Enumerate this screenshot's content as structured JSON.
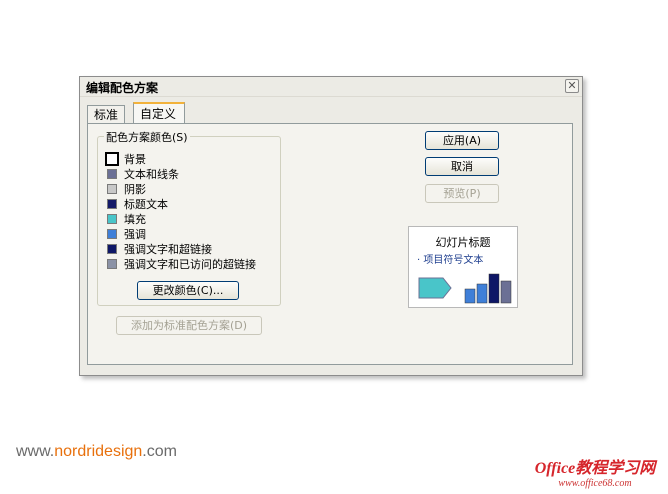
{
  "dialog": {
    "title": "编辑配色方案",
    "close_glyph": "✕",
    "tabs": [
      {
        "label": "标准",
        "active": false
      },
      {
        "label": "自定义",
        "active": true
      }
    ],
    "group_label": "配色方案颜色(S)",
    "colors": [
      {
        "label": "背景",
        "color": "#ffffff",
        "selected": true
      },
      {
        "label": "文本和线条",
        "color": "#6b7095",
        "selected": false
      },
      {
        "label": "阴影",
        "color": "#c8c8c8",
        "selected": false
      },
      {
        "label": "标题文本",
        "color": "#141a68",
        "selected": false
      },
      {
        "label": "填充",
        "color": "#49c5c9",
        "selected": false
      },
      {
        "label": "强调",
        "color": "#3f7fd8",
        "selected": false
      },
      {
        "label": "强调文字和超链接",
        "color": "#0e1666",
        "selected": false
      },
      {
        "label": "强调文字和已访问的超链接",
        "color": "#8b92a6",
        "selected": false
      }
    ],
    "change_color_button": "更改颜色(C)...",
    "add_scheme_button": "添加为标准配色方案(D)",
    "apply_button": "应用(A)",
    "cancel_button": "取消",
    "preview_button": "预览(P)",
    "preview": {
      "title": "幻灯片标题",
      "bullet": "· 项目符号文本",
      "bars": [
        {
          "level": 0.45,
          "color": "#3f7fd8"
        },
        {
          "level": 0.6,
          "color": "#3f7fd8"
        },
        {
          "level": 0.9,
          "color": "#0e1666"
        },
        {
          "level": 0.7,
          "color": "#6b7095"
        }
      ]
    }
  },
  "watermark": {
    "left_prefix": "www.",
    "left_accent": "nordridesign",
    "left_suffix": ".com",
    "right_brand": "Office教程学习网",
    "right_url": "www.office68.com"
  },
  "colors": {
    "dialog_bg": "#ecebe5",
    "tab_highlight": "#f2b23b",
    "button_border": "#003c74",
    "accent_orange": "#e8700c",
    "brand_red": "#d6262c"
  }
}
